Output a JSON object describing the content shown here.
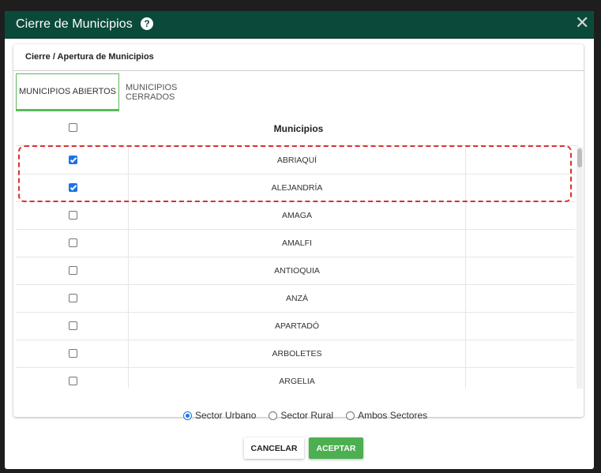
{
  "dialog": {
    "title": "Cierre de Municipios",
    "help_symbol": "?",
    "close_symbol": "✕"
  },
  "card": {
    "title": "Cierre / Apertura de Municipios"
  },
  "tabs": [
    {
      "label": "MUNICIPIOS ABIERTOS",
      "active": true
    },
    {
      "label": "MUNICIPIOS CERRADOS",
      "active": false
    }
  ],
  "table": {
    "header": "Municipios",
    "select_all_checked": false,
    "rows": [
      {
        "name": "ABRIAQUÍ",
        "checked": true
      },
      {
        "name": "ALEJANDRÍA",
        "checked": true
      },
      {
        "name": "AMAGA",
        "checked": false
      },
      {
        "name": "AMALFI",
        "checked": false
      },
      {
        "name": "ANTIOQUIA",
        "checked": false
      },
      {
        "name": "ANZÁ",
        "checked": false
      },
      {
        "name": "APARTADÓ",
        "checked": false
      },
      {
        "name": "ARBOLETES",
        "checked": false
      },
      {
        "name": "ARGELIA",
        "checked": false
      }
    ]
  },
  "sector_options": [
    {
      "label": "Sector Urbano",
      "selected": true
    },
    {
      "label": "Sector Rural",
      "selected": false
    },
    {
      "label": "Ambos Sectores",
      "selected": false
    }
  ],
  "buttons": {
    "cancel": "CANCELAR",
    "accept": "ACEPTAR"
  },
  "colors": {
    "titlebar": "#0b4a3b",
    "accent_green": "#4caf50",
    "checkbox_blue": "#1a73e8",
    "highlight_red": "#d9302e"
  }
}
